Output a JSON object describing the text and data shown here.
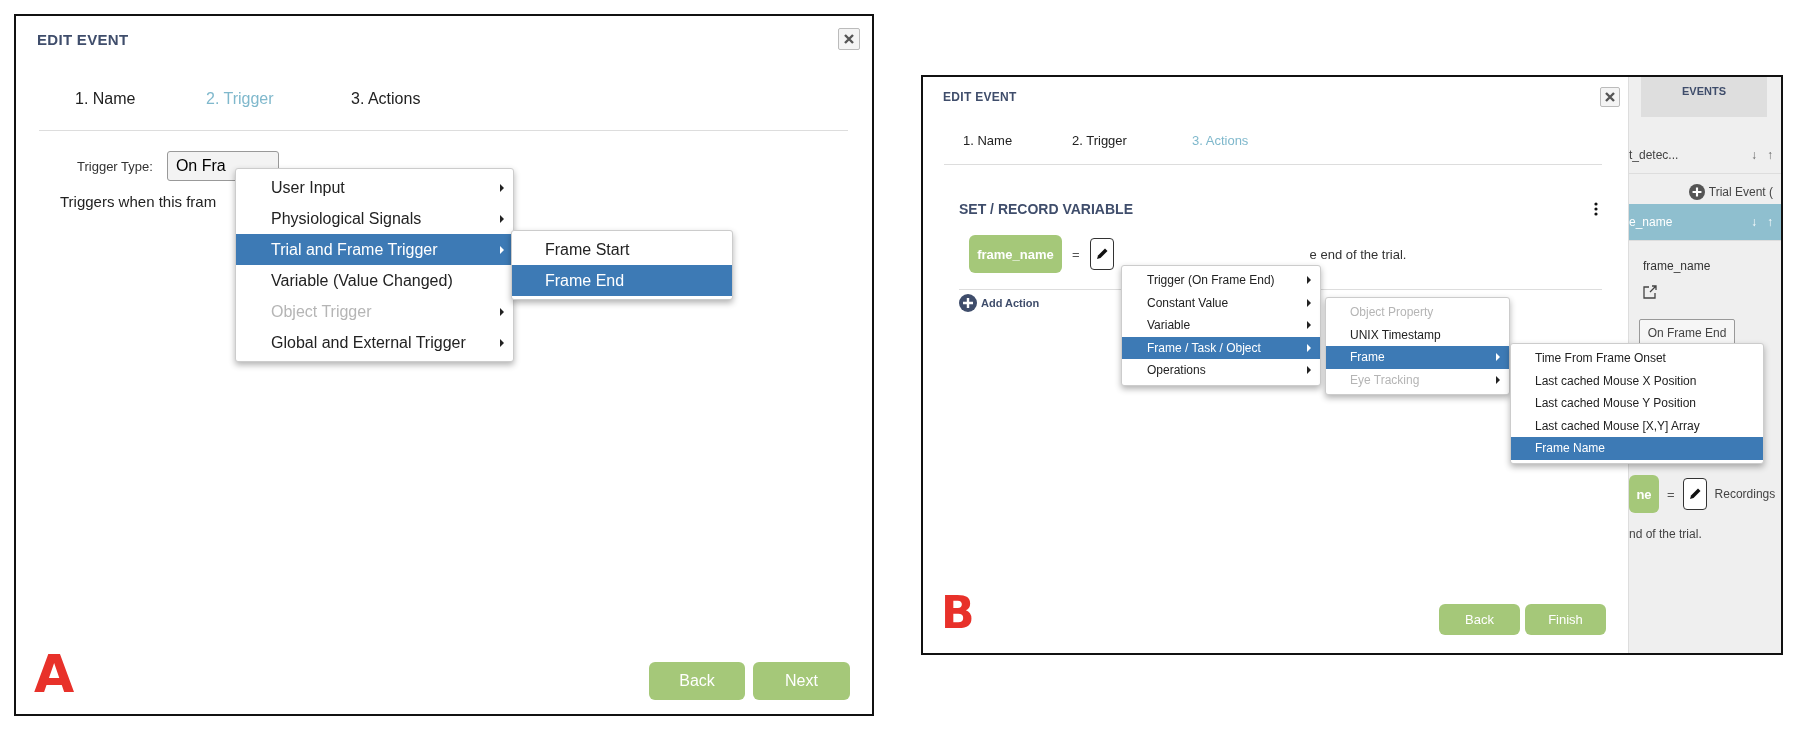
{
  "panel_a": {
    "label": "A",
    "title": "EDIT EVENT",
    "steps": [
      {
        "label": "1. Name",
        "selected": false
      },
      {
        "label": "2. Trigger",
        "selected": true
      },
      {
        "label": "3. Actions",
        "selected": false
      }
    ],
    "trigger_type_label": "Trigger Type:",
    "trigger_select_value": "On Fra",
    "description": "Triggers when this fram",
    "menu": [
      {
        "label": "User Input",
        "selected": false,
        "disabled": false,
        "has_submenu": true
      },
      {
        "label": "Physiological Signals",
        "selected": false,
        "disabled": false,
        "has_submenu": true
      },
      {
        "label": "Trial and Frame Trigger",
        "selected": true,
        "disabled": false,
        "has_submenu": true
      },
      {
        "label": "Variable (Value Changed)",
        "selected": false,
        "disabled": false,
        "has_submenu": false
      },
      {
        "label": "Object Trigger",
        "selected": false,
        "disabled": true,
        "has_submenu": true
      },
      {
        "label": "Global and External Trigger",
        "selected": false,
        "disabled": false,
        "has_submenu": true
      }
    ],
    "submenu": [
      {
        "label": "Frame Start",
        "selected": false,
        "disabled": false,
        "has_submenu": false
      },
      {
        "label": "Frame End",
        "selected": true,
        "disabled": false,
        "has_submenu": false
      }
    ],
    "buttons": [
      "Back",
      "Next"
    ]
  },
  "panel_b": {
    "label": "B",
    "title": "EDIT EVENT",
    "steps": [
      {
        "label": "1. Name",
        "selected": false
      },
      {
        "label": "2. Trigger",
        "selected": false
      },
      {
        "label": "3. Actions",
        "selected": true
      }
    ],
    "section_title": "SET / RECORD VARIABLE",
    "variable_chip": "frame_name",
    "equals": "=",
    "value_text": "e end of the trial.",
    "add_action": "Add Action",
    "menu": [
      {
        "label": "Trigger (On Frame End)",
        "selected": false,
        "disabled": false,
        "has_submenu": true
      },
      {
        "label": "Constant Value",
        "selected": false,
        "disabled": false,
        "has_submenu": true
      },
      {
        "label": "Variable",
        "selected": false,
        "disabled": false,
        "has_submenu": true
      },
      {
        "label": "Frame / Task / Object",
        "selected": true,
        "disabled": false,
        "has_submenu": true
      },
      {
        "label": "Operations",
        "selected": false,
        "disabled": false,
        "has_submenu": true
      }
    ],
    "submenu": [
      {
        "label": "Object Property",
        "selected": false,
        "disabled": true,
        "has_submenu": false
      },
      {
        "label": "UNIX Timestamp",
        "selected": false,
        "disabled": false,
        "has_submenu": false
      },
      {
        "label": "Frame",
        "selected": true,
        "disabled": false,
        "has_submenu": true
      },
      {
        "label": "Eye Tracking",
        "selected": false,
        "disabled": true,
        "has_submenu": true
      }
    ],
    "submenu_2": [
      {
        "label": "Time From Frame Onset",
        "selected": false,
        "disabled": false,
        "has_submenu": false
      },
      {
        "label": "Last cached Mouse X Position",
        "selected": false,
        "disabled": false,
        "has_submenu": false
      },
      {
        "label": "Last cached Mouse Y Position",
        "selected": false,
        "disabled": false,
        "has_submenu": false
      },
      {
        "label": "Last cached Mouse [X,Y] Array",
        "selected": false,
        "disabled": false,
        "has_submenu": false
      },
      {
        "label": "Frame Name",
        "selected": true,
        "disabled": false,
        "has_submenu": false
      }
    ],
    "buttons": [
      "Back",
      "Finish"
    ],
    "events_panel": {
      "tab": "EVENTS",
      "event_row": "t_detec...",
      "down_arrow": "↓",
      "up_arrow": "↑",
      "add_trial_event": "Trial Event (",
      "selected_row": "e_name",
      "selected_down": "↓",
      "selected_up": "↑",
      "variable_name": "frame_name",
      "trigger_button": "On Frame End",
      "chip": "ne",
      "equals": "=",
      "value_text": "Recordings",
      "trailing_text": "nd of the trial."
    }
  }
}
